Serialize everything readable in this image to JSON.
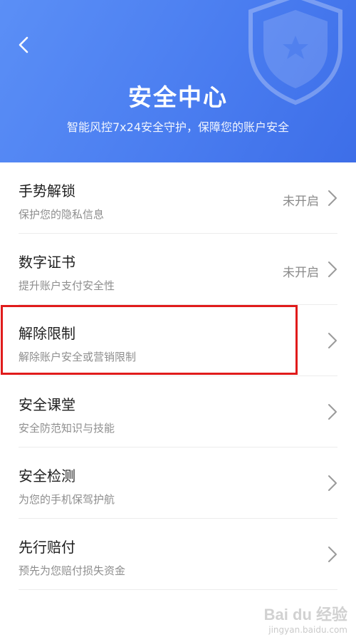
{
  "header": {
    "title": "安全中心",
    "subtitle": "智能风控7x24安全守护，保障您的账户安全",
    "bg_color": "#4a7df0"
  },
  "items": [
    {
      "title": "手势解锁",
      "desc": "保护您的隐私信息",
      "status": "未开启"
    },
    {
      "title": "数字证书",
      "desc": "提升账户支付安全性",
      "status": "未开启"
    },
    {
      "title": "解除限制",
      "desc": "解除账户安全或营销限制",
      "status": ""
    },
    {
      "title": "安全课堂",
      "desc": "安全防范知识与技能",
      "status": ""
    },
    {
      "title": "安全检测",
      "desc": "为您的手机保驾护航",
      "status": ""
    },
    {
      "title": "先行赔付",
      "desc": "预先为您赔付损失资金",
      "status": ""
    }
  ],
  "highlight_color": "#e01b1b",
  "watermark": {
    "logo": "Bai du 经验",
    "url": "jingyan.baidu.com"
  }
}
